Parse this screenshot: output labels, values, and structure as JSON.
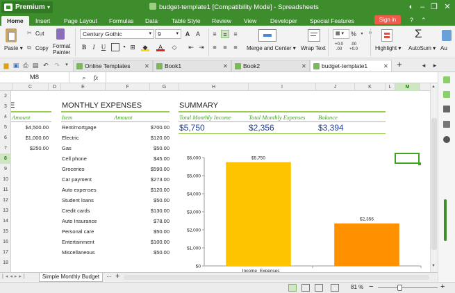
{
  "titlebar": {
    "premium": "Premium",
    "premium_arrow": "▾",
    "title": "budget-template1 [Compatibility Mode] - Spreadsheets"
  },
  "menu": {
    "tabs": [
      "Home",
      "Insert",
      "Page Layout",
      "Formulas",
      "Data",
      "Table Style",
      "Review",
      "View",
      "Developer",
      "Special Features"
    ],
    "signin": "Sign in"
  },
  "ribbon": {
    "paste": "Paste",
    "cut": "Cut",
    "copy": "Copy",
    "format_painter_1": "Format",
    "format_painter_2": "Painter",
    "font": "Century Gothic",
    "size": "9",
    "merge": "Merge and Center",
    "wrap": "Wrap Text",
    "percent": "%",
    "highlight": "Highlight",
    "autosum": "AutoSum",
    "autofit": "Au",
    "increase": "+0.0 .00",
    "decrease": ".00 +0.0"
  },
  "doc_tabs": {
    "online": "Online Templates",
    "book1": "Book1",
    "book2": "Book2",
    "active": "budget-template1",
    "plus": "+"
  },
  "formula_bar": {
    "cell": "M8",
    "fx": "fx"
  },
  "columns": [
    "B",
    "C",
    "D",
    "E",
    "F",
    "G",
    "H",
    "I",
    "J",
    "K",
    "L",
    "M"
  ],
  "rows": [
    "2",
    "3",
    "4",
    "5",
    "6",
    "7",
    "8",
    "9",
    "10",
    "11",
    "12",
    "13",
    "14",
    "15",
    "16",
    "17",
    "18"
  ],
  "income": {
    "header": "Amount",
    "values": [
      "$4,500.00",
      "$1,000.00",
      "$250.00"
    ]
  },
  "expenses": {
    "title": "MONTHLY EXPENSES",
    "col_item": "Item",
    "col_amount": "Amount",
    "items": [
      {
        "item": "Rent/mortgage",
        "amount": "$700.00"
      },
      {
        "item": "Electric",
        "amount": "$120.00"
      },
      {
        "item": "Gas",
        "amount": "$50.00"
      },
      {
        "item": "Cell phone",
        "amount": "$45.00"
      },
      {
        "item": "Groceries",
        "amount": "$590.00"
      },
      {
        "item": "Car payment",
        "amount": "$273.00"
      },
      {
        "item": "Auto expenses",
        "amount": "$120.00"
      },
      {
        "item": "Student loans",
        "amount": "$50.00"
      },
      {
        "item": "Credit cards",
        "amount": "$130.00"
      },
      {
        "item": "Auto Insurance",
        "amount": "$78.00"
      },
      {
        "item": "Personal care",
        "amount": "$50.00"
      },
      {
        "item": "Entertainment",
        "amount": "$100.00"
      },
      {
        "item": "Miscellaneous",
        "amount": "$50.00"
      }
    ]
  },
  "summary": {
    "title": "SUMMARY",
    "label_income": "Total Monthly Income",
    "label_expenses": "Total Monthly Expenses",
    "label_balance": "Balance",
    "income": "$5,750",
    "expenses": "$2,356",
    "balance": "$3,394"
  },
  "chart_data": {
    "type": "bar",
    "categories": [
      "Income",
      "Expenses"
    ],
    "values": [
      5750,
      2356
    ],
    "data_labels": [
      "$5,750",
      "$2,356"
    ],
    "ylim": [
      0,
      6000
    ],
    "yticks": [
      "$0",
      "$1,000",
      "$2,000",
      "$3,000",
      "$4,000",
      "$5,000",
      "$6,000"
    ],
    "colors": [
      "#ffc400",
      "#ff9000"
    ],
    "title": "",
    "xlabel": "",
    "ylabel": ""
  },
  "sheet_tabs": {
    "active": "Simple Monthly Budget",
    "more": "···",
    "add": "+"
  },
  "status": {
    "zoom": "81 %",
    "minus": "−",
    "plus": "+"
  },
  "colors": {
    "accent": "#3d8d2c",
    "green_text": "#3ea51e",
    "blue_value": "#1f3fa0",
    "underline": "#9bcc4c"
  }
}
